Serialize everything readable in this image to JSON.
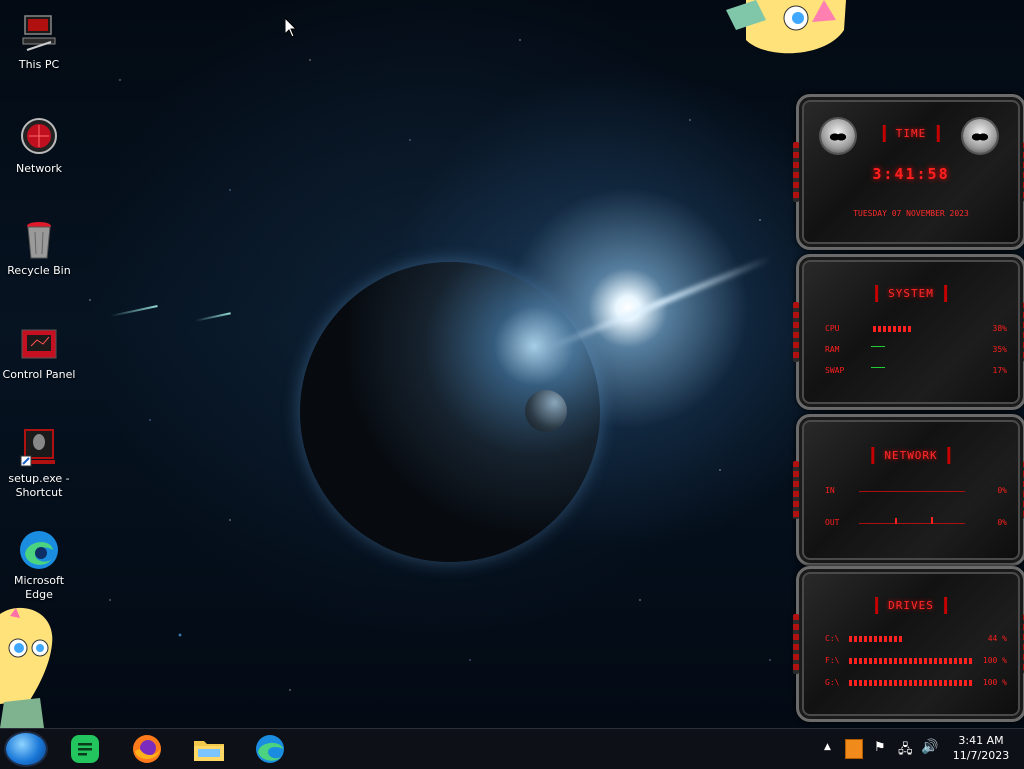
{
  "desktop": {
    "icons": [
      {
        "label": "This PC",
        "icon": "computer-icon"
      },
      {
        "label": "Network",
        "icon": "network-icon"
      },
      {
        "label": "Recycle Bin",
        "icon": "recycle-bin-icon"
      },
      {
        "label": "Control Panel",
        "icon": "control-panel-icon"
      },
      {
        "label": "setup.exe - Shortcut",
        "icon": "setup-shortcut-icon"
      },
      {
        "label": "Microsoft Edge",
        "icon": "edge-icon"
      }
    ]
  },
  "widgets": {
    "time": {
      "title": "Time",
      "clock": "3:41:58",
      "date": "Tuesday 07 November 2023"
    },
    "system": {
      "title": "System",
      "rows": [
        {
          "label": "CPU",
          "value": "38%",
          "fill": 0.38
        },
        {
          "label": "RAM",
          "value": "35%",
          "fill": 0.35
        },
        {
          "label": "SWAP",
          "value": "17%",
          "fill": 0.17
        }
      ]
    },
    "network": {
      "title": "Network",
      "rows": [
        {
          "label": "IN",
          "value": "0%"
        },
        {
          "label": "OUT",
          "value": "0%"
        }
      ]
    },
    "drives": {
      "title": "Drives",
      "rows": [
        {
          "label": "C:\\",
          "value": "44 %",
          "fill": 0.44
        },
        {
          "label": "F:\\",
          "value": "100 %",
          "fill": 1.0
        },
        {
          "label": "G:\\",
          "value": "100 %",
          "fill": 1.0
        }
      ]
    }
  },
  "taskbar": {
    "apps": [
      {
        "name": "Spotify",
        "icon": "notes-icon"
      },
      {
        "name": "Firefox",
        "icon": "firefox-icon"
      },
      {
        "name": "File Explorer",
        "icon": "folder-icon"
      },
      {
        "name": "Microsoft Edge",
        "icon": "edge-icon"
      }
    ],
    "tray": {
      "time": "3:41 AM",
      "date": "11/7/2023"
    }
  },
  "colors": {
    "accent_red": "#ff1e1e",
    "taskbar_bg": "#0d1017",
    "start_blue": "#1a78d8"
  }
}
